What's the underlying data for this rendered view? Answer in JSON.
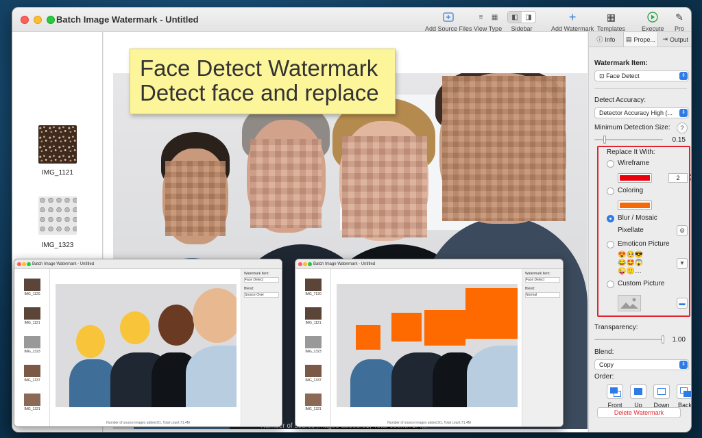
{
  "window": {
    "title": "Batch Image Watermark - Untitled"
  },
  "toolbar": {
    "add_source": "Add Source Files",
    "view_type": "View Type",
    "sidebar": "Sidebar",
    "add_watermark": "Add Watermark",
    "templates": "Templates",
    "execute": "Execute",
    "pro": "Pro"
  },
  "files": [
    {
      "name": "IMG_1121"
    },
    {
      "name": "IMG_1323"
    }
  ],
  "banner": {
    "line1": "Face Detect Watermark",
    "line2": "Detect face and replace"
  },
  "inspector": {
    "tabs": {
      "info": "Info",
      "properties": "Prope...",
      "output": "Output"
    },
    "watermark_item_label": "Watermark Item:",
    "watermark_item_value": "Face Detect",
    "detect_accuracy_label": "Detect Accuracy:",
    "detect_accuracy_value": "Detector Accuracy High (...",
    "min_size_label": "Minimum Detection Size:",
    "min_size_help": "?",
    "min_size_value": "0.15",
    "min_size_fraction": 0.15,
    "replace_label": "Replace It With:",
    "wireframe": "Wireframe",
    "wireframe_width": "2",
    "wireframe_color": "#e8000c",
    "coloring": "Coloring",
    "coloring_color": "#f26a0a",
    "blur": "Blur / Mosaic",
    "pixellate": "Pixellate",
    "emoticon": "Emoticon Picture",
    "custom": "Custom Picture",
    "transparency_label": "Transparency:",
    "transparency_value": "1.00",
    "transparency_fraction": 1.0,
    "blend_label": "Blend:",
    "blend_value": "Copy",
    "order_label": "Order:",
    "order": {
      "front": "Front",
      "up": "Up",
      "down": "Down",
      "back": "Back"
    },
    "delete": "Delete Watermark"
  },
  "mini_left": {
    "title": "Batch Image Watermark - Untitled",
    "files": [
      "IMG_1120",
      "IMG_1121",
      "IMG_1323",
      "IMG_1337",
      "IMG_1321"
    ],
    "watermark_item": "Face Detect",
    "blend": "Source Over",
    "footer": "Number of source images added:81, Total count:71.4M"
  },
  "mini_right": {
    "title": "Batch Image Watermark - Untitled",
    "files": [
      "IMG_7120",
      "IMG_1121",
      "IMG_1323",
      "IMG_1337",
      "IMG_1321"
    ],
    "watermark_item": "Face Detect",
    "blend": "Normal",
    "footer": "Number of source images added:81, Total count:71.4M"
  },
  "colors": {
    "accent": "#2f7be6",
    "highlight": "#e0242e",
    "banner": "#fdf59a"
  }
}
